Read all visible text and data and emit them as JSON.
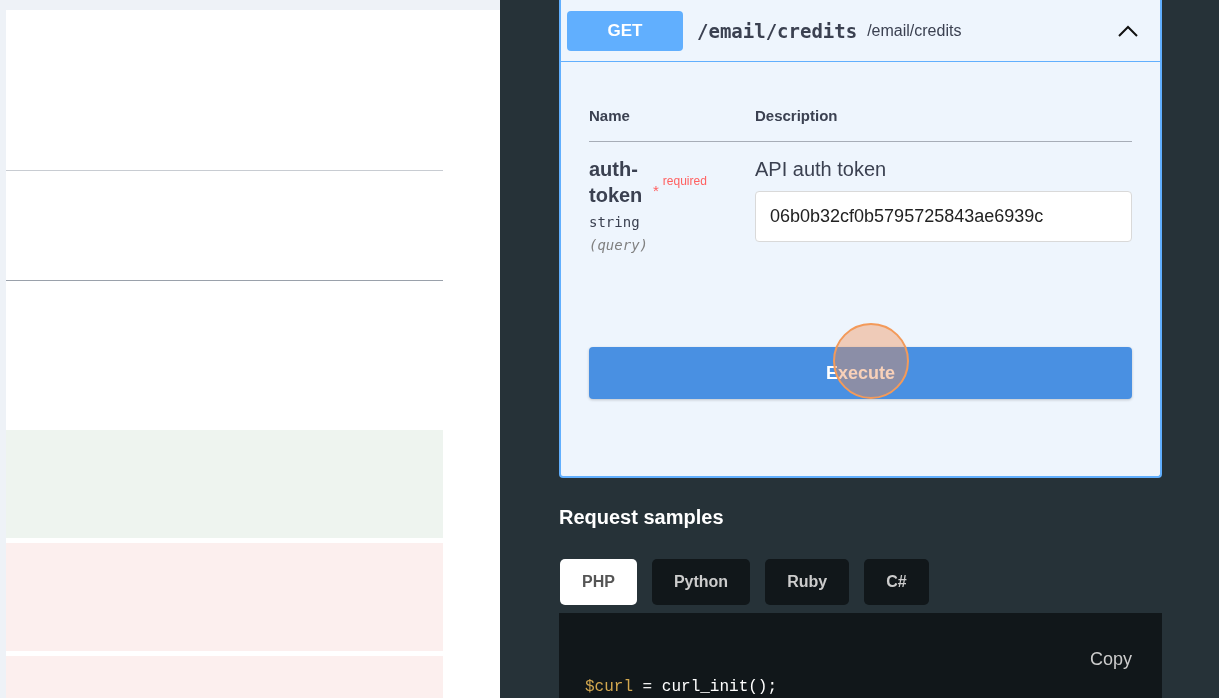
{
  "left_panel": {
    "rows": [
      {
        "color": "#eef4ef"
      },
      {
        "color": "#fcefee"
      },
      {
        "color": "#fcefee"
      }
    ]
  },
  "operation": {
    "method": "GET",
    "path": "/email/credits",
    "summary": "/email/credits",
    "expanded": true,
    "columns": [
      "Name",
      "Description"
    ],
    "parameters": [
      {
        "name": "auth-token",
        "required_mark": "*",
        "required_label": "required",
        "type": "string",
        "location": "(query)",
        "description": "API auth token",
        "value": "06b0b32cf0b5795725843ae6939c"
      }
    ],
    "execute_label": "Execute"
  },
  "request_samples": {
    "title": "Request samples",
    "tabs": [
      {
        "label": "PHP",
        "selected": true
      },
      {
        "label": "Python",
        "selected": false
      },
      {
        "label": "Ruby",
        "selected": false
      },
      {
        "label": "C#",
        "selected": false
      }
    ],
    "copy_label": "Copy",
    "code": [
      {
        "var": "$curl",
        "op": "=",
        "rest": "curl_init();"
      }
    ]
  }
}
